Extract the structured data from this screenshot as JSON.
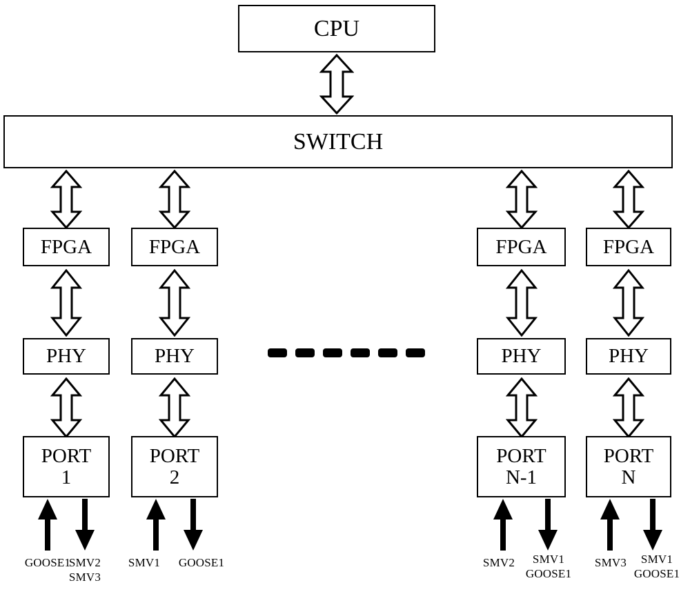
{
  "diagram": {
    "title": "Multi-port protection device architecture",
    "stroke_color": "#000000",
    "background_color": "#ffffff"
  },
  "nodes": {
    "cpu": {
      "label": "CPU"
    },
    "switch": {
      "label": "SWITCH"
    },
    "fpga": [
      {
        "label": "FPGA"
      },
      {
        "label": "FPGA"
      },
      {
        "label": "FPGA"
      },
      {
        "label": "FPGA"
      }
    ],
    "phy": [
      {
        "label": "PHY"
      },
      {
        "label": "PHY"
      },
      {
        "label": "PHY"
      },
      {
        "label": "PHY"
      }
    ],
    "port": [
      {
        "label": "PORT\n1"
      },
      {
        "label": "PORT\n2"
      },
      {
        "label": "PORT\nN-1"
      },
      {
        "label": "PORT\nN"
      }
    ]
  },
  "ellipsis": {
    "dash_count": 6
  },
  "io_labels": [
    {
      "text": "GOOSE1",
      "direction": "in"
    },
    {
      "text": "SMV2\nSMV3",
      "direction": "out"
    },
    {
      "text": "SMV1",
      "direction": "in"
    },
    {
      "text": "GOOSE1",
      "direction": "out"
    },
    {
      "text": "SMV2",
      "direction": "in"
    },
    {
      "text": "SMV1\nGOOSE1",
      "direction": "out"
    },
    {
      "text": "SMV3",
      "direction": "in"
    },
    {
      "text": "SMV1\nGOOSE1",
      "direction": "out"
    }
  ]
}
